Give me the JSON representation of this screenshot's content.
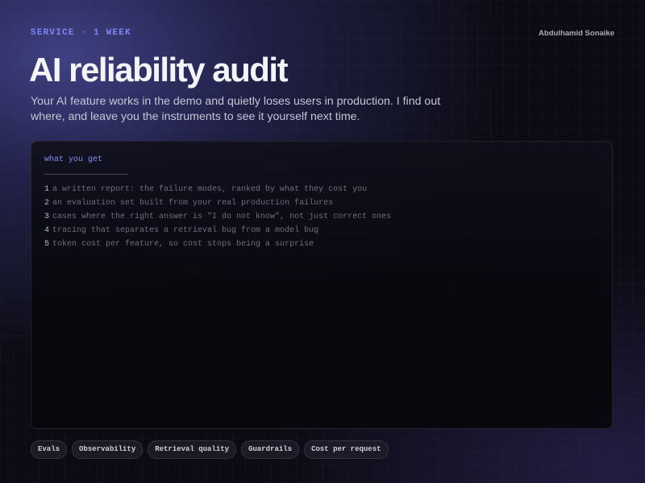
{
  "header": {
    "eyebrow": "SERVICE · 1 WEEK",
    "author": "Abdulhamid Sonaike"
  },
  "hero": {
    "title": "AI reliability audit",
    "subtitle": "Your AI feature works in the demo and quietly loses users in production. I find out where, and leave you the instruments to see it yourself next time."
  },
  "panel": {
    "heading": "what you get",
    "items": [
      {
        "num": "1",
        "text": "a written report: the failure modes, ranked by what they cost you"
      },
      {
        "num": "2",
        "text": "an evaluation set built from your real production failures"
      },
      {
        "num": "3",
        "text": "cases where the right answer is \"I do not know\", not just correct ones"
      },
      {
        "num": "4",
        "text": "tracing that separates a retrieval bug from a model bug"
      },
      {
        "num": "5",
        "text": "token cost per feature, so cost stops being a surprise"
      }
    ]
  },
  "tags": [
    "Evals",
    "Observability",
    "Retrieval quality",
    "Guardrails",
    "Cost per request"
  ],
  "colors": {
    "accent": "#7f86f5",
    "background": "#0b0b13",
    "title": "#f4f4fa"
  }
}
